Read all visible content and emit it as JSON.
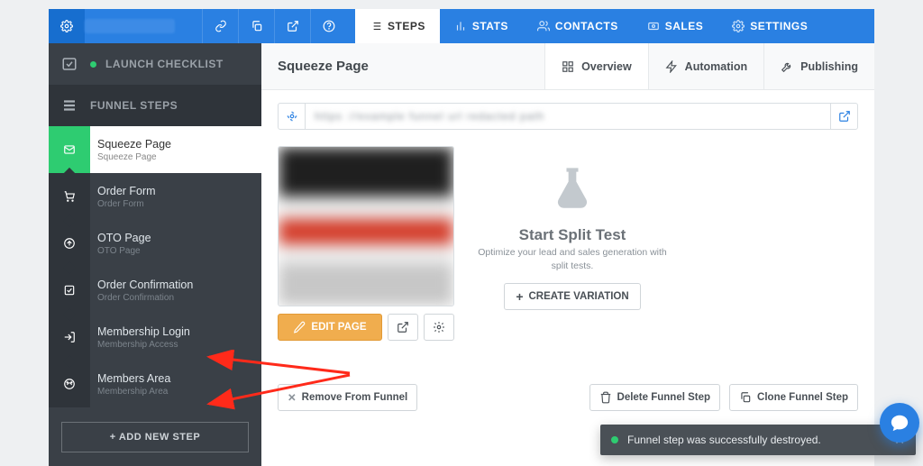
{
  "topbar": {
    "steps": "STEPS",
    "stats": "STATS",
    "contacts": "CONTACTS",
    "sales": "SALES",
    "settings": "SETTINGS"
  },
  "sidebar": {
    "launch_checklist": "LAUNCH CHECKLIST",
    "funnel_steps": "FUNNEL STEPS",
    "steps": [
      {
        "title": "Squeeze Page",
        "subtitle": "Squeeze Page"
      },
      {
        "title": "Order Form",
        "subtitle": "Order Form"
      },
      {
        "title": "OTO Page",
        "subtitle": "OTO Page"
      },
      {
        "title": "Order Confirmation",
        "subtitle": "Order Confirmation"
      },
      {
        "title": "Membership Login",
        "subtitle": "Membership Access"
      },
      {
        "title": "Members Area",
        "subtitle": "Membership Area"
      }
    ],
    "add_new_step": "+   ADD NEW STEP"
  },
  "main": {
    "title": "Squeeze Page",
    "subtabs": {
      "overview": "Overview",
      "automation": "Automation",
      "publishing": "Publishing"
    },
    "edit_page": "EDIT PAGE",
    "split": {
      "title": "Start Split Test",
      "subtitle": "Optimize your lead and sales generation with split tests.",
      "create_variation": "CREATE VARIATION"
    },
    "footer": {
      "remove": "Remove From Funnel",
      "delete": "Delete Funnel Step",
      "clone": "Clone Funnel Step"
    }
  },
  "toast": "Funnel step was successfully destroyed."
}
